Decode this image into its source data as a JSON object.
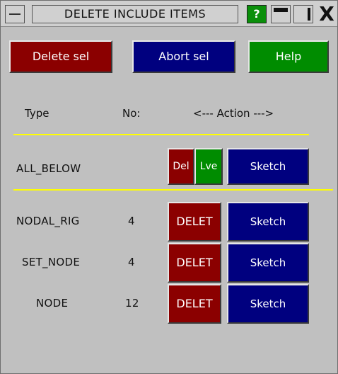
{
  "window": {
    "title": "DELETE INCLUDE ITEMS",
    "help_glyph": "?",
    "close_glyph": "X"
  },
  "toolbar": {
    "delete_sel": "Delete sel",
    "abort_sel": "Abort sel",
    "help": "Help"
  },
  "columns": {
    "type": "Type",
    "no": "No:",
    "action": "<--- Action --->"
  },
  "all_below": {
    "label": "ALL_BELOW",
    "del": "Del",
    "lve": "Lve",
    "sketch": "Sketch"
  },
  "rows": [
    {
      "type": "NODAL_RIG",
      "no": "4",
      "delet": "DELET",
      "sketch": "Sketch"
    },
    {
      "type": "SET_NODE",
      "no": "4",
      "delet": "DELET",
      "sketch": "Sketch"
    },
    {
      "type": "NODE",
      "no": "12",
      "delet": "DELET",
      "sketch": "Sketch"
    }
  ],
  "colors": {
    "red": "#8b0000",
    "blue": "#00007f",
    "green": "#008c00",
    "yellow_divider": "#ffff00"
  }
}
